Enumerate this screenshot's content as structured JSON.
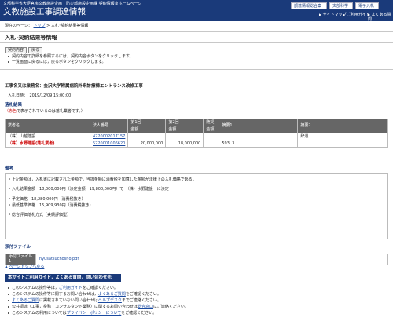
{
  "header": {
    "subtitle": "文部科学省大臣官房文教施設企画・防災部施設企画課 契約情報室ホームページ",
    "title": "文教施設工事調達情報",
    "top_buttons": [
      "調達情報総合案内",
      "文部科学省",
      "電子入札"
    ],
    "nav": [
      "サイトマップ",
      "ご利用ガイド",
      "よくある質問"
    ],
    "nav_icon": "triangle-right-icon"
  },
  "breadcrumb": {
    "prefix": "現在のページ：",
    "home": "トップ",
    "sep": ">",
    "current": "入札･契約結果等情報"
  },
  "page_title": "入札･契約結果等情報",
  "buttons": {
    "contract": "契約内容",
    "back": "戻る"
  },
  "notes": [
    "契約内容の詳細を参照するには，契約内容ボタンをクリックします。",
    "一覧画面に戻るには，戻るボタンをクリックします。"
  ],
  "work_name": "工事名又は業務名：金沢大学附属病院外来診療棟エントランス改修工事",
  "bid_date": "入札日時：　2019/12/09 15:00:00",
  "result_section": "落札結果",
  "result_note_red": "（赤色",
  "result_note_rest": "で表示されているのは落札業者です。）",
  "table": {
    "headers": [
      "業者名",
      "法人番号",
      "第1回",
      "第2回",
      "随契",
      "摘要1",
      "摘要2"
    ],
    "subheaders": [
      "金額",
      "金額",
      "金額"
    ],
    "rows": [
      {
        "name": "（株）山越建設",
        "corp": "4220002017157",
        "r1": "",
        "r2": "",
        "zuikei": "",
        "note1": "",
        "note2": "辞退"
      },
      {
        "name": "（株）水野建設(落札業者)",
        "corp": "5220001006620",
        "r1": "20,000,000",
        "r2": "18,000,000",
        "zuikei": "",
        "note1": "593,.3",
        "note2": ""
      }
    ]
  },
  "remarks_title": "備考",
  "remarks": [
    "・上記金額は，入札書に記載された金額で，当該金額に消費税を加算した金額が法律上の入札価格である。",
    "・入札結果金額　18,000,000円（決定金額　19,800,000円）で　（株）水野建設　に決定",
    "・予定価格　18,280,000円（消費税抜き）",
    "・最低基準価格　15,909,930円（消費税抜き）",
    "・総合評価落札方式［実績評価型］"
  ],
  "attach_section": "添付ファイル",
  "attach": {
    "label": "添付ファイル1",
    "file": "nyusatsuchosho.pdf"
  },
  "back_to_top": "ページトップへ戻る",
  "help": {
    "title": "本サイトご利用ガイド，よくある質問，問い合わせ先",
    "items": [
      [
        {
          "t": "このシステムの操作等は，"
        },
        {
          "t": "ご利用ガイド",
          "l": true
        },
        {
          "t": "をご確認ください。"
        }
      ],
      [
        {
          "t": "このシステムの操作等に関するお問い合わせは，"
        },
        {
          "t": "よくあるご質問",
          "l": true
        },
        {
          "t": "をご確認ください。"
        }
      ],
      [
        {
          "t": "よくあるご質問",
          "l": true
        },
        {
          "t": "に掲載されていない問い合わせは"
        },
        {
          "t": "ヘルプデスク",
          "l": true
        },
        {
          "t": "までご連絡ください。"
        }
      ],
      [
        {
          "t": "公共調達（工事，役務・コンサルタント業務）に関するお問い合わせは"
        },
        {
          "t": "総合窓口",
          "l": true
        },
        {
          "t": "にご連絡ください。"
        }
      ],
      [
        {
          "t": "このシステムの利用については"
        },
        {
          "t": "プライバシーポリシーについて",
          "l": true
        },
        {
          "t": "をご確認ください。"
        }
      ]
    ]
  }
}
